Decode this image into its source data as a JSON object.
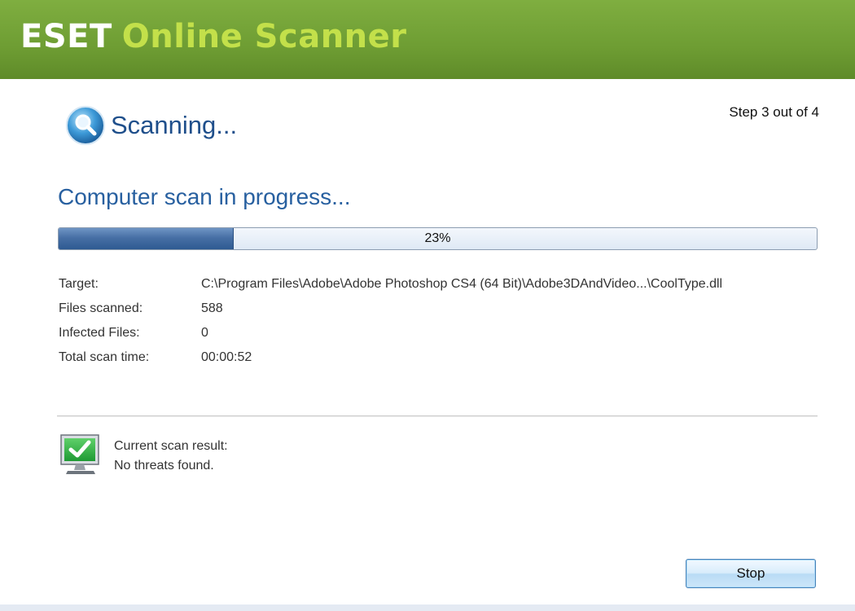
{
  "header": {
    "brand_eset": "ESET",
    "brand_product": "Online Scanner",
    "colors": {
      "bar": "#6e9d33",
      "product_text": "#c3e04a"
    }
  },
  "status": {
    "icon": "magnifier-icon",
    "title": "Scanning...",
    "step_text": "Step 3 out of 4"
  },
  "progress": {
    "heading": "Computer scan in progress...",
    "percent": 23,
    "label": "23%"
  },
  "details": [
    {
      "label": "Target:",
      "value": "C:\\Program Files\\Adobe\\Adobe Photoshop CS4 (64 Bit)\\Adobe3DAndVideo...\\CoolType.dll"
    },
    {
      "label": "Files scanned:",
      "value": "588"
    },
    {
      "label": "Infected Files:",
      "value": "0"
    },
    {
      "label": "Total scan time:",
      "value": "00:00:52"
    }
  ],
  "result": {
    "icon": "monitor-checkmark-icon",
    "line1": "Current scan result:",
    "line2": "No threats found."
  },
  "actions": {
    "stop_label": "Stop"
  }
}
